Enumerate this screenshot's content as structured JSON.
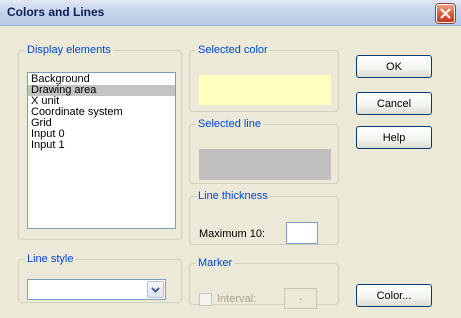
{
  "window": {
    "title": "Colors and Lines"
  },
  "display_elements": {
    "legend": "Display elements",
    "items": [
      "Background",
      "Drawing area",
      "X unit",
      "Coordinate system",
      "Grid",
      "Input  0",
      "Input  1"
    ],
    "selected": "Drawing area"
  },
  "selected_color": {
    "legend": "Selected color",
    "color": "#ffffc0"
  },
  "selected_line": {
    "legend": "Selected line",
    "color": "#c0c0c0"
  },
  "line_thickness": {
    "legend": "Line thickness",
    "label": "Maximum 10:",
    "value": ""
  },
  "line_style": {
    "legend": "Line style",
    "value": ""
  },
  "marker": {
    "legend": "Marker",
    "interval_label": "Interval:",
    "interval_value": "-",
    "checked": false
  },
  "buttons": {
    "ok": "OK",
    "cancel": "Cancel",
    "help": "Help",
    "color": "Color..."
  },
  "colors": {
    "accent_text": "#0046d5",
    "disabled_text": "#a5a496"
  }
}
